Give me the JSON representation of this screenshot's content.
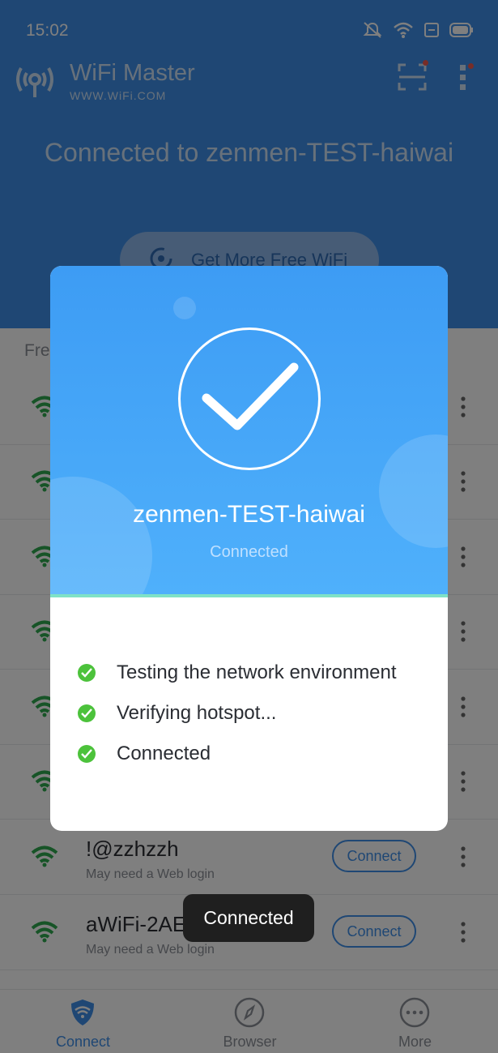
{
  "status_bar": {
    "time": "15:02"
  },
  "app_bar": {
    "title": "WiFi Master",
    "subtitle": "WWW.WiFi.COM"
  },
  "header": {
    "connected_text": "Connected to zenmen-TEST-haiwai",
    "more_wifi_label": "Get More Free WiFi"
  },
  "list": {
    "section_label": "Fre",
    "rows": [
      {
        "ssid": "",
        "hint": "",
        "connect_label": ""
      },
      {
        "ssid": "",
        "hint": "",
        "connect_label": ""
      },
      {
        "ssid": "",
        "hint": "",
        "connect_label": ""
      },
      {
        "ssid": "",
        "hint": "",
        "connect_label": ""
      },
      {
        "ssid": "",
        "hint": "",
        "connect_label": ""
      },
      {
        "ssid": "",
        "hint": "",
        "connect_label": ""
      },
      {
        "ssid": "!@zzhzzh",
        "hint": "May need a Web login",
        "connect_label": "Connect"
      },
      {
        "ssid": "aWiFi-2AE",
        "hint": "May need a Web login",
        "connect_label": "Connect"
      }
    ]
  },
  "dialog": {
    "ssid": "zenmen-TEST-haiwai",
    "state": "Connected",
    "steps": [
      {
        "text": "Testing the network environment"
      },
      {
        "text": "Verifying hotspot..."
      },
      {
        "text": "Connected"
      }
    ]
  },
  "toast": {
    "text": "Connected"
  },
  "tabs": [
    {
      "label": "Connect",
      "icon": "wifi-shield-icon"
    },
    {
      "label": "Browser",
      "icon": "compass-icon"
    },
    {
      "label": "More",
      "icon": "more-dots-icon"
    }
  ],
  "colors": {
    "primary": "#3f8fe8",
    "success": "#4cc23b",
    "wifi_green": "#2ea84f"
  }
}
